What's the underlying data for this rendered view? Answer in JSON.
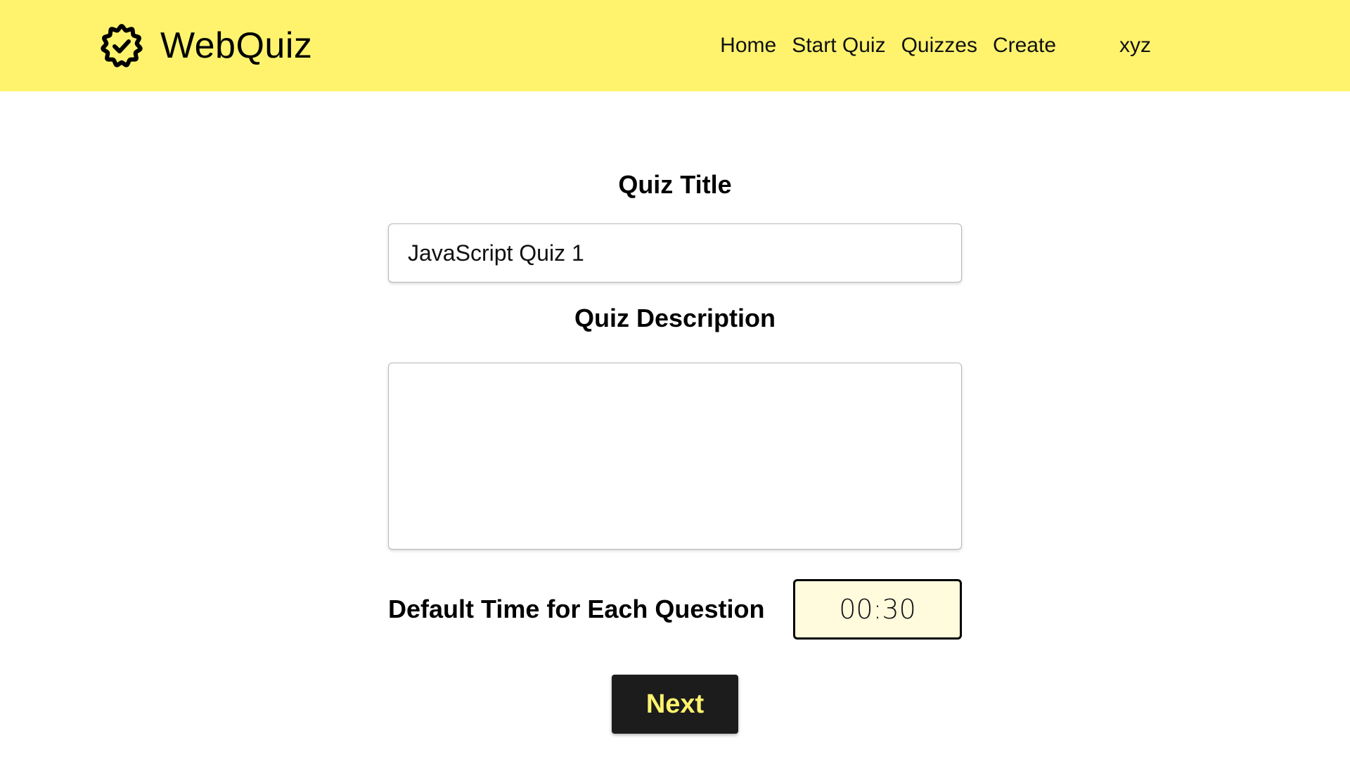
{
  "header": {
    "brand": {
      "name": "WebQuiz",
      "icon": "badge-check-icon"
    },
    "nav": {
      "items": [
        {
          "label": "Home"
        },
        {
          "label": "Start Quiz"
        },
        {
          "label": "Quizzes"
        },
        {
          "label": "Create"
        }
      ],
      "user": "xyz"
    },
    "background_color": "#fff36e"
  },
  "form": {
    "title_label": "Quiz Title",
    "title_value": "JavaScript Quiz 1",
    "description_label": "Quiz Description",
    "description_value": "",
    "time_label": "Default Time for Each Question",
    "time_value": "00:30",
    "next_label": "Next"
  },
  "colors": {
    "accent_yellow": "#fff36e",
    "button_dark": "#1c1c1c",
    "time_field_bg": "#fffbdc"
  }
}
